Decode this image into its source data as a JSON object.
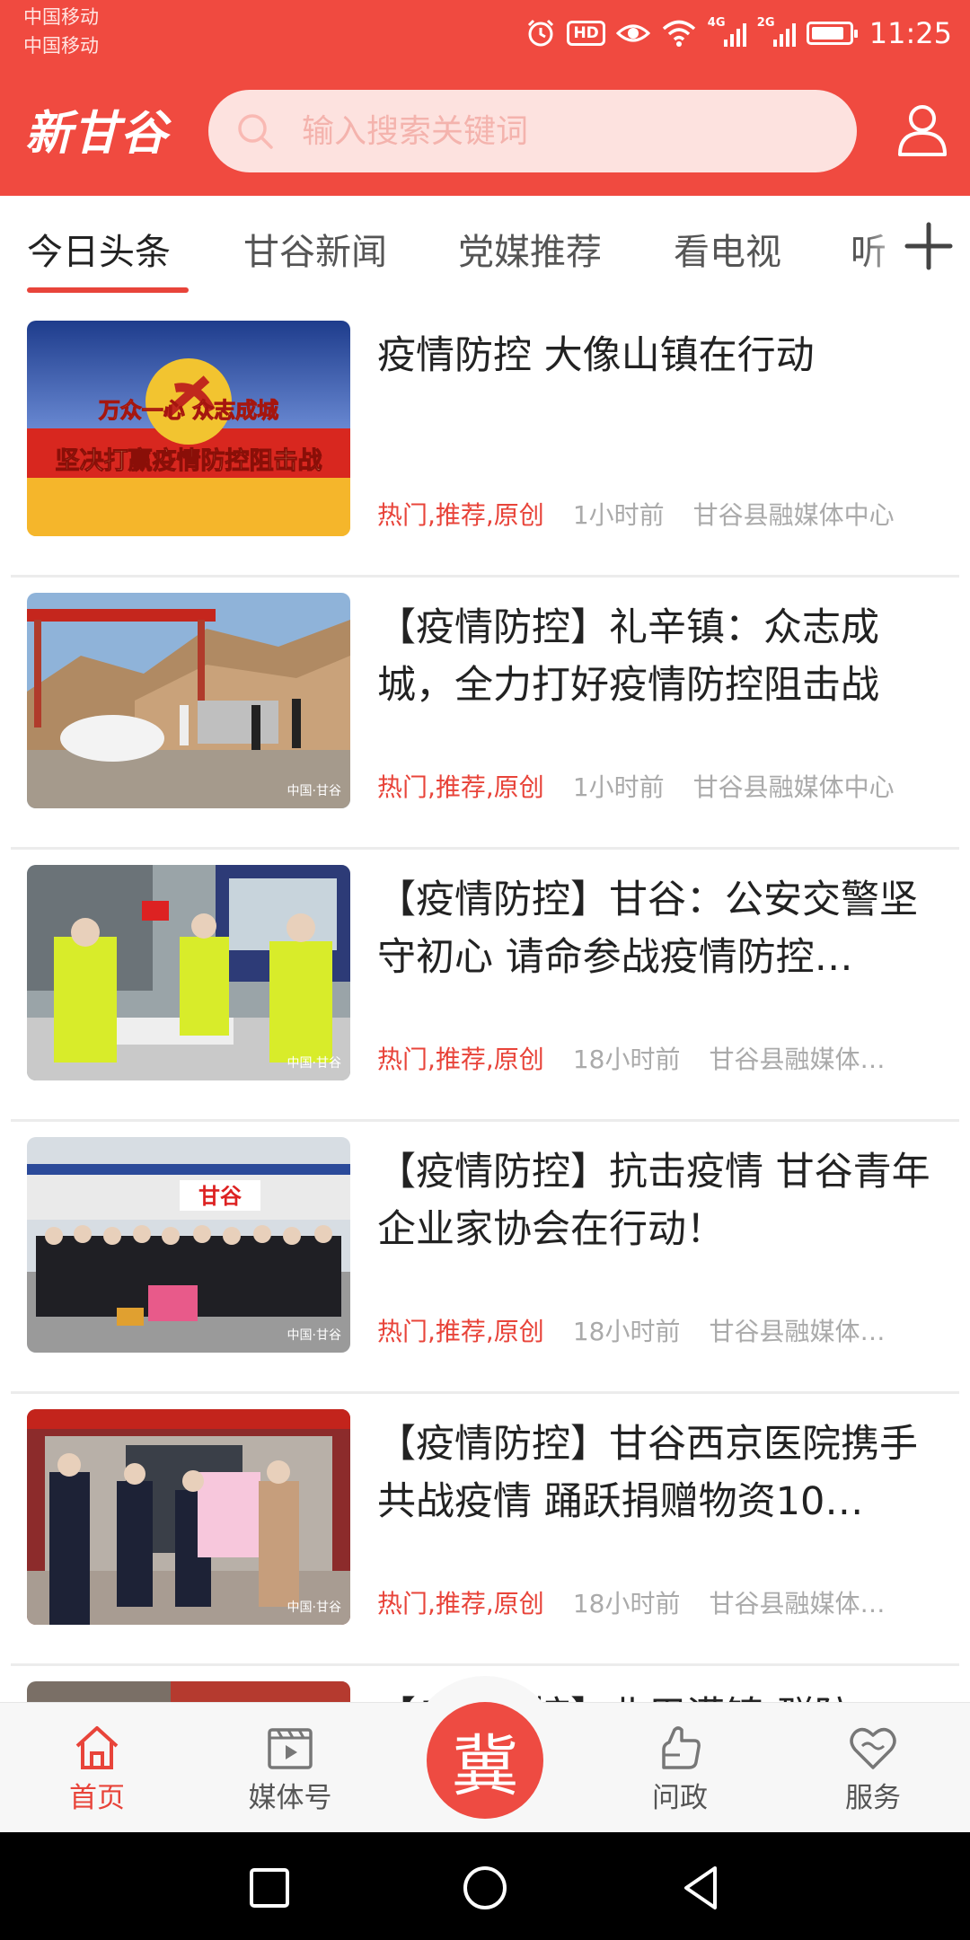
{
  "status_bar": {
    "carrier_1": "中国移动",
    "carrier_2": "中国移动",
    "hd_badge": "HD",
    "signal_1_label": "4G",
    "signal_2_label": "2G",
    "time": "11:25",
    "icons": [
      "alarm-icon",
      "hd-icon",
      "eye-comfort-icon",
      "wifi-icon",
      "signal-4g-icon",
      "signal-2g-icon",
      "battery-icon"
    ]
  },
  "app_bar": {
    "logo": "新甘谷",
    "search_placeholder": "输入搜索关键词",
    "brand_color": "#f04a40"
  },
  "tabs": [
    {
      "label": "今日头条",
      "active": true
    },
    {
      "label": "甘谷新闻",
      "active": false
    },
    {
      "label": "党媒推荐",
      "active": false
    },
    {
      "label": "看电视",
      "active": false
    },
    {
      "label": "听",
      "active": false
    }
  ],
  "news": [
    {
      "title": "疫情防控 大像山镇在行动",
      "tags": "热门,推荐,原创",
      "time": "1小时前",
      "source": "甘谷县融媒体中心",
      "thumb_banner_1": "万众一心 众志成城",
      "thumb_banner_2": "坚决打赢疫情防控阻击战"
    },
    {
      "title": "【疫情防控】礼辛镇：众志成城，全力打好疫情防控阻击战",
      "tags": "热门,推荐,原创",
      "time": "1小时前",
      "source": "甘谷县融媒体中心",
      "thumb_watermark": "中国·甘谷"
    },
    {
      "title": "【疫情防控】甘谷：公安交警坚守初心 请命参战疫情防控…",
      "tags": "热门,推荐,原创",
      "time": "18小时前",
      "source": "甘谷县融媒体…",
      "thumb_watermark": "中国·甘谷"
    },
    {
      "title": "【疫情防控】抗击疫情 甘谷青年企业家协会在行动！",
      "tags": "热门,推荐,原创",
      "time": "18小时前",
      "source": "甘谷县融媒体…",
      "thumb_sign": "甘谷",
      "thumb_watermark": "中国·甘谷"
    },
    {
      "title": "【疫情防控】甘谷西京医院携手共战疫情 踊跃捐赠物资10…",
      "tags": "热门,推荐,原创",
      "time": "18小时前",
      "source": "甘谷县融媒体…",
      "thumb_watermark": "中国·甘谷"
    },
    {
      "title": "【疫情防控】北用漠镇 群防",
      "tags": "",
      "time": "",
      "source": ""
    }
  ],
  "bottom_nav": {
    "items": [
      {
        "label": "首页",
        "icon": "home-icon",
        "active": true
      },
      {
        "label": "媒体号",
        "icon": "video-icon",
        "active": false
      },
      {
        "label": "问政",
        "icon": "hand-icon",
        "active": false
      },
      {
        "label": "服务",
        "icon": "heart-icon",
        "active": false
      }
    ],
    "center_label": "冀",
    "active_color": "#e8443a"
  },
  "system_nav": [
    "recent-apps-icon",
    "home-circle-icon",
    "back-icon"
  ]
}
